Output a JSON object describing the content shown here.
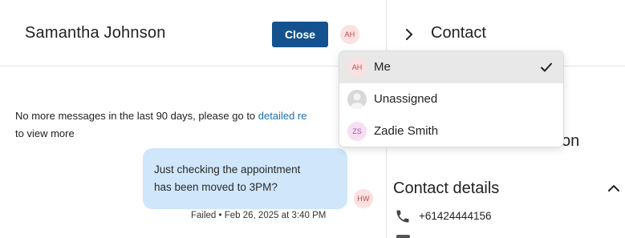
{
  "conversation": {
    "contact_name": "Samantha Johnson",
    "close_label": "Close",
    "assignee_initials": "AH",
    "notice_text": "No more messages in the last 90 days, please go to ",
    "notice_link": "detailed re",
    "notice_tail": "to view more",
    "message": {
      "line1": "Just checking the appointment",
      "line2": "has been moved to 3PM?",
      "status": "Failed • Feb 26, 2025 at 3:40 PM",
      "sender_initials": "HW"
    }
  },
  "assign_menu": {
    "items": [
      {
        "label": "Me",
        "initials": "AH",
        "selected": true
      },
      {
        "label": "Unassigned",
        "initials": "",
        "selected": false
      },
      {
        "label": "Zadie Smith",
        "initials": "ZS",
        "selected": false
      }
    ]
  },
  "contact_panel": {
    "title": "Contact",
    "obscured_text": "on",
    "section_title": "Contact details",
    "phone": "+61424444156"
  },
  "colors": {
    "primary": "#13528e",
    "bubble": "#cfe6fb",
    "link": "#1e6fb3",
    "avatar_red_bg": "#fbe1e1",
    "avatar_pink_bg": "#f7def3"
  },
  "icons": [
    "chevron-right-icon",
    "chevron-up-icon",
    "phone-icon",
    "checkmark-icon",
    "user-placeholder-icon"
  ]
}
